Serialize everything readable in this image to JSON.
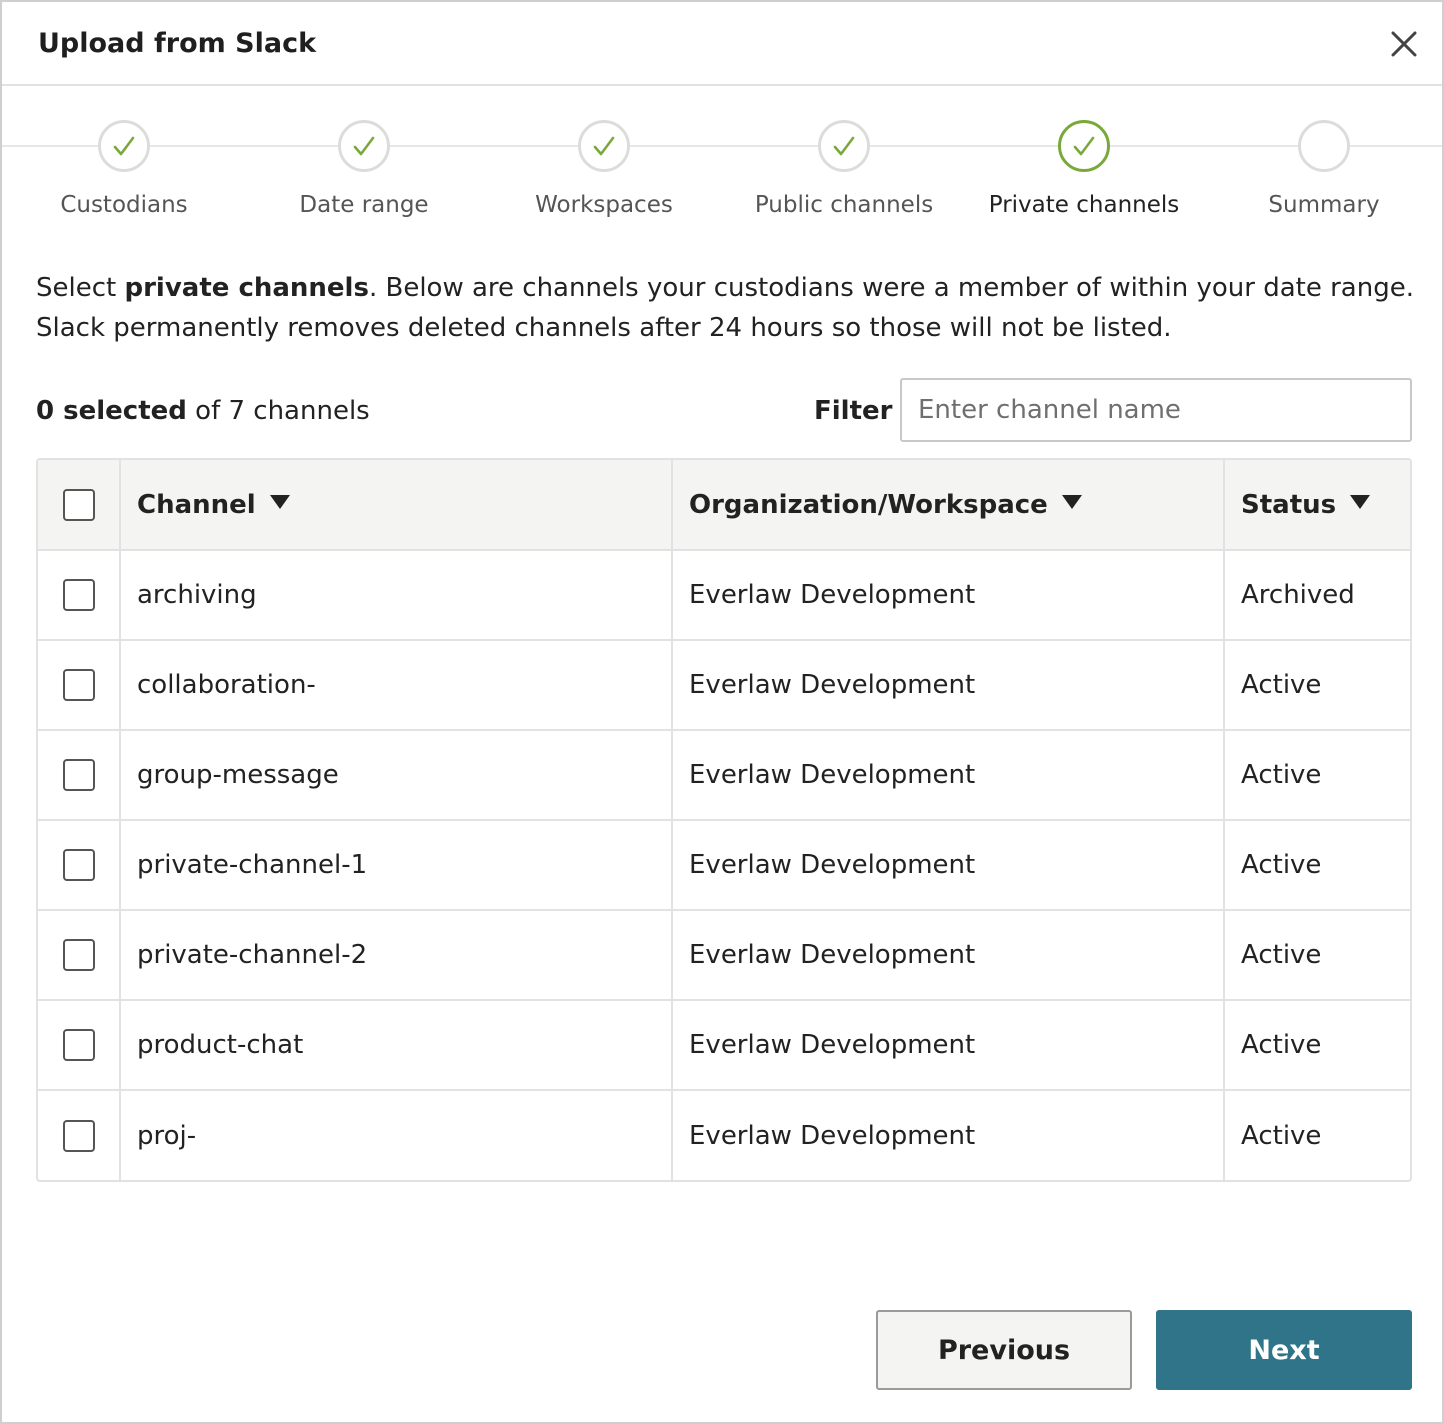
{
  "dialog": {
    "title": "Upload from Slack"
  },
  "stepper": {
    "steps": [
      {
        "label": "Custodians",
        "state": "complete"
      },
      {
        "label": "Date range",
        "state": "complete"
      },
      {
        "label": "Workspaces",
        "state": "complete"
      },
      {
        "label": "Public channels",
        "state": "complete"
      },
      {
        "label": "Private channels",
        "state": "current"
      },
      {
        "label": "Summary",
        "state": "pending"
      }
    ]
  },
  "description": {
    "prefix": "Select ",
    "emphasis": "private channels",
    "suffix": ". Below are channels your custodians were a member of within your date range. Slack permanently removes deleted channels after 24 hours so those will not be listed."
  },
  "selection": {
    "count_label": "0 selected",
    "total_label": " of 7 channels"
  },
  "filter": {
    "label": "Filter",
    "placeholder": "Enter channel name",
    "value": ""
  },
  "table": {
    "headers": {
      "channel": "Channel",
      "organization": "Organization/Workspace",
      "status": "Status"
    },
    "rows": [
      {
        "channel": "archiving",
        "organization": "Everlaw Development",
        "status": "Archived"
      },
      {
        "channel": "collaboration-",
        "organization": "Everlaw Development",
        "status": "Active"
      },
      {
        "channel": "group-message",
        "organization": "Everlaw Development",
        "status": "Active"
      },
      {
        "channel": "private-channel-1",
        "organization": "Everlaw Development",
        "status": "Active"
      },
      {
        "channel": "private-channel-2",
        "organization": "Everlaw Development",
        "status": "Active"
      },
      {
        "channel": "product-chat",
        "organization": "Everlaw Development",
        "status": "Active"
      },
      {
        "channel": "proj-",
        "organization": "Everlaw Development",
        "status": "Active"
      }
    ]
  },
  "footer": {
    "previous_label": "Previous",
    "next_label": "Next"
  },
  "colors": {
    "check_green": "#7aa93a",
    "primary_button": "#2f7489",
    "header_bg": "#f4f4f2"
  }
}
